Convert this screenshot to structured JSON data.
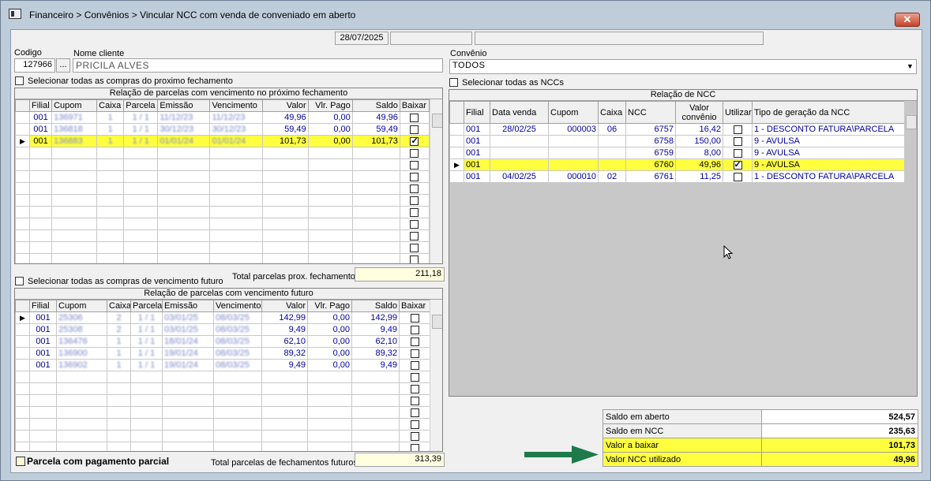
{
  "window": {
    "title": "Financeiro > Convênios > Vincular NCC com venda de conveniado em aberto",
    "close_label": "✕"
  },
  "header": {
    "date": "28/07/2025",
    "field2": "",
    "field3": ""
  },
  "client": {
    "codigo_label": "Codigo",
    "codigo_value": "127966",
    "browse_label": "...",
    "nome_label": "Nome cliente",
    "nome_value": "PRICILA ALVES"
  },
  "convenio": {
    "label": "Convênio",
    "value": "TODOS"
  },
  "select_all_next": "Selecionar todas as compras do proximo fechamento",
  "select_all_ncc": "Selecionar todas as NCCs",
  "select_all_future": "Selecionar todas as compras de vencimento futuro",
  "grid_next": {
    "title": "Relação de parcelas com vencimento no próximo fechamento",
    "columns": [
      "Filial",
      "Cupom",
      "Caixa",
      "Parcela",
      "Emissão",
      "Vencimento",
      "Valor",
      "Vlr. Pago",
      "Saldo",
      "Baixar"
    ],
    "rows": [
      {
        "filial": "001",
        "cupom": "136971",
        "caixa": "1",
        "parcela": "1 / 1",
        "emissao": "11/12/23",
        "vencimento": "11/12/23",
        "valor": "49,96",
        "pago": "0,00",
        "saldo": "49,96",
        "baixar": false,
        "hl": false,
        "cur": false
      },
      {
        "filial": "001",
        "cupom": "136818",
        "caixa": "1",
        "parcela": "1 / 1",
        "emissao": "30/12/23",
        "vencimento": "30/12/23",
        "valor": "59,49",
        "pago": "0,00",
        "saldo": "59,49",
        "baixar": false,
        "hl": false,
        "cur": false
      },
      {
        "filial": "001",
        "cupom": "136883",
        "caixa": "1",
        "parcela": "1 / 1",
        "emissao": "01/01/24",
        "vencimento": "01/01/24",
        "valor": "101,73",
        "pago": "0,00",
        "saldo": "101,73",
        "baixar": true,
        "hl": true,
        "cur": true
      }
    ],
    "total_label": "Total parcelas prox. fechamento",
    "total_value": "211,18"
  },
  "grid_future": {
    "title": "Relação de parcelas com vencimento futuro",
    "columns": [
      "Filial",
      "Cupom",
      "Caixa",
      "Parcela",
      "Emissão",
      "Vencimento",
      "Valor",
      "Vlr. Pago",
      "Saldo",
      "Baixar"
    ],
    "rows": [
      {
        "filial": "001",
        "cupom": "25306",
        "caixa": "2",
        "parcela": "1 / 1",
        "emissao": "03/01/25",
        "vencimento": "08/03/25",
        "valor": "142,99",
        "pago": "0,00",
        "saldo": "142,99",
        "baixar": false,
        "cur": true
      },
      {
        "filial": "001",
        "cupom": "25308",
        "caixa": "2",
        "parcela": "1 / 1",
        "emissao": "03/01/25",
        "vencimento": "08/03/25",
        "valor": "9,49",
        "pago": "0,00",
        "saldo": "9,49",
        "baixar": false,
        "cur": false
      },
      {
        "filial": "001",
        "cupom": "136476",
        "caixa": "1",
        "parcela": "1 / 1",
        "emissao": "18/01/24",
        "vencimento": "08/03/25",
        "valor": "62,10",
        "pago": "0,00",
        "saldo": "62,10",
        "baixar": false,
        "cur": false
      },
      {
        "filial": "001",
        "cupom": "136900",
        "caixa": "1",
        "parcela": "1 / 1",
        "emissao": "19/01/24",
        "vencimento": "08/03/25",
        "valor": "89,32",
        "pago": "0,00",
        "saldo": "89,32",
        "baixar": false,
        "cur": false
      },
      {
        "filial": "001",
        "cupom": "136902",
        "caixa": "1",
        "parcela": "1 / 1",
        "emissao": "19/01/24",
        "vencimento": "08/03/25",
        "valor": "9,49",
        "pago": "0,00",
        "saldo": "9,49",
        "baixar": false,
        "cur": false
      }
    ],
    "total_label": "Total parcelas de fechamentos futuros",
    "total_value": "313,39"
  },
  "parcial_label": "Parcela com pagamento parcial",
  "grid_ncc": {
    "title": "Relação de NCC",
    "columns": [
      "Filial",
      "Data venda",
      "Cupom",
      "Caixa",
      "NCC",
      "Valor convênio",
      "Utilizar",
      "Tipo de geração da NCC"
    ],
    "rows": [
      {
        "filial": "001",
        "data": "28/02/25",
        "cupom": "000003",
        "caixa": "06",
        "ncc": "6757",
        "valor": "16,42",
        "utilizar": false,
        "tipo": "1 - DESCONTO FATURA\\PARCELA",
        "hl": false
      },
      {
        "filial": "001",
        "data": "",
        "cupom": "",
        "caixa": "",
        "ncc": "6758",
        "valor": "150,00",
        "utilizar": false,
        "tipo": "9 - AVULSA",
        "hl": false
      },
      {
        "filial": "001",
        "data": "",
        "cupom": "",
        "caixa": "",
        "ncc": "6759",
        "valor": "8,00",
        "utilizar": false,
        "tipo": "9 - AVULSA",
        "hl": false
      },
      {
        "filial": "001",
        "data": "",
        "cupom": "",
        "caixa": "",
        "ncc": "6760",
        "valor": "49,96",
        "utilizar": true,
        "tipo": "9 - AVULSA",
        "hl": true
      },
      {
        "filial": "001",
        "data": "04/02/25",
        "cupom": "000010",
        "caixa": "02",
        "ncc": "6761",
        "valor": "11,25",
        "utilizar": false,
        "tipo": "1 - DESCONTO FATURA\\PARCELA",
        "hl": false
      }
    ]
  },
  "summary": [
    {
      "label": "Saldo em aberto",
      "value": "524,57",
      "hl": false
    },
    {
      "label": "Saldo em NCC",
      "value": "235,63",
      "hl": false
    },
    {
      "label": "Valor a baixar",
      "value": "101,73",
      "hl": true
    },
    {
      "label": "Valor NCC utilizado",
      "value": "49,96",
      "hl": true
    }
  ],
  "colors": {
    "highlight": "#ffff40",
    "arrow": "#1e7a4a",
    "window_frame": "#bfcddb"
  },
  "icons": {
    "close": "close-icon",
    "row_pointer": "row-pointer-icon",
    "dropdown": "chevron-down-icon",
    "arrow": "arrow-right-icon"
  }
}
